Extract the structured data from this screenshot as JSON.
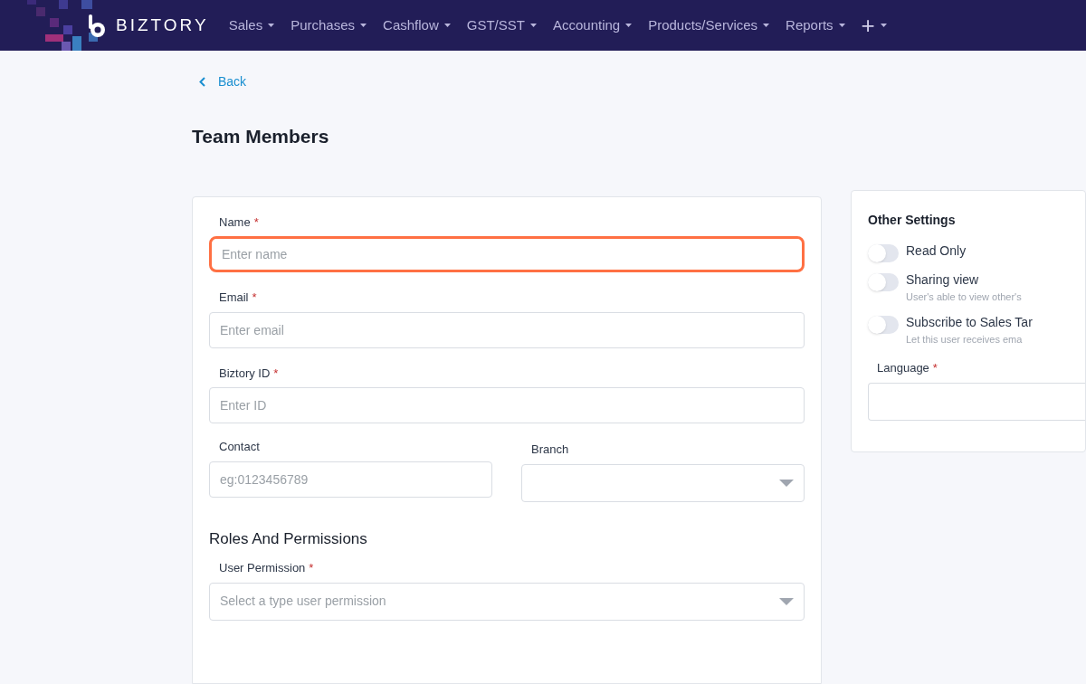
{
  "nav": {
    "brand": "BIZTORY",
    "items": [
      {
        "label": "Sales"
      },
      {
        "label": "Purchases"
      },
      {
        "label": "Cashflow"
      },
      {
        "label": "GST/SST"
      },
      {
        "label": "Accounting"
      },
      {
        "label": "Products/Services"
      },
      {
        "label": "Reports"
      },
      {
        "label": "+"
      }
    ]
  },
  "back": "Back",
  "title": "Team Members",
  "form": {
    "fields": [
      {
        "label": "Name",
        "required": "*",
        "placeholder": "Enter name",
        "kind": "input",
        "focused": true
      },
      {
        "label": "Email",
        "required": "*",
        "placeholder": "Enter email",
        "kind": "input",
        "focused": false
      },
      {
        "label": "Biztory ID",
        "required": "*",
        "placeholder": "Enter ID",
        "kind": "input",
        "focused": false
      }
    ],
    "row": [
      {
        "label": "Contact",
        "placeholder": "eg:0123456789",
        "kind": "input"
      },
      {
        "label": "Branch",
        "kind": "select"
      }
    ],
    "section": "Roles And Permissions",
    "permission": {
      "label": "User Permission",
      "required": "*",
      "placeholder": "Select a type user permission",
      "kind": "select"
    }
  },
  "settings": {
    "title": "Other Settings",
    "toggles": [
      {
        "label": "Read Only",
        "on": false
      },
      {
        "label": "Sharing view",
        "hint": "User's able to view other's",
        "on": false
      },
      {
        "label": "Subscribe to Sales Tar",
        "hint": "Let this user receives ema",
        "on": false
      }
    ],
    "language": {
      "label": "Language",
      "required": "*"
    }
  }
}
